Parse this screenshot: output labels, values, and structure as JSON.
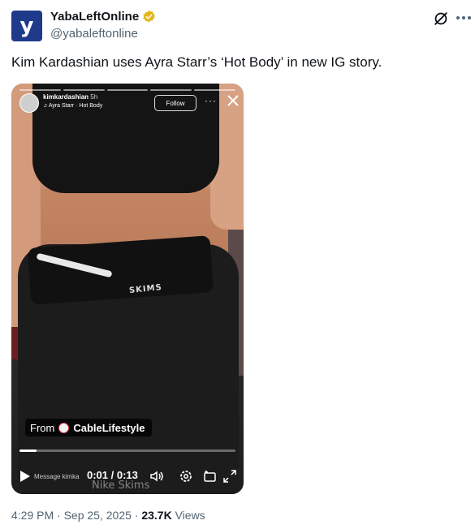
{
  "author": {
    "avatar_letter": "y",
    "display_name": "YabaLeftOnline",
    "handle": "@yabaleftonline",
    "verified_color": "#e2b719"
  },
  "tweet": {
    "text": "Kim Kardashian uses Ayra Starr’s ‘Hot Body’ in new IG story."
  },
  "icons": {
    "top_action": "grok-icon",
    "more": "more-icon"
  },
  "media": {
    "story": {
      "username": "kimkardashian",
      "time": "5h",
      "song": "Ayra Starr · Hot Body",
      "follow_label": "Follow",
      "dots": "···"
    },
    "from_prefix": "From",
    "from_source": "CableLifestyle",
    "progress": 0.08,
    "message_hint": "Message kimka",
    "timecode": "0:01 / 0:13",
    "watermark": "Nike Skims",
    "logo_text": "SKIMS"
  },
  "footer": {
    "time": "4:29 PM",
    "sep1": "·",
    "date": "Sep 25, 2025",
    "sep2": "·",
    "views_count": "23.7K",
    "views_label": "Views"
  }
}
